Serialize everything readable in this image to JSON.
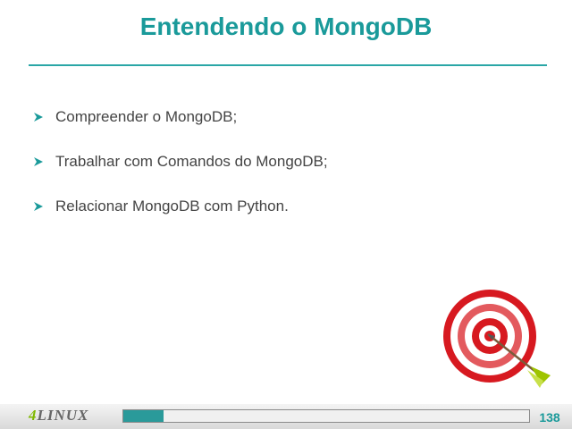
{
  "slide": {
    "title": "Entendendo o MongoDB",
    "bullets": [
      {
        "text": "Compreender o MongoDB;"
      },
      {
        "text": "Trabalhar com Comandos do MongoDB;"
      },
      {
        "text": "Relacionar MongoDB com Python."
      }
    ]
  },
  "footer": {
    "logo_number": "4",
    "logo_word": "LINUX",
    "progress_fraction": 0.1,
    "page_number": "138"
  },
  "colors": {
    "accent": "#1a9a9a",
    "bullet_arrow": "#1a9a9a",
    "target_red": "#d71920",
    "arrow_fletch": "#9ec400"
  },
  "icons": {
    "bullet": "arrow-bullet-icon",
    "illustration": "dartboard-target-icon"
  }
}
